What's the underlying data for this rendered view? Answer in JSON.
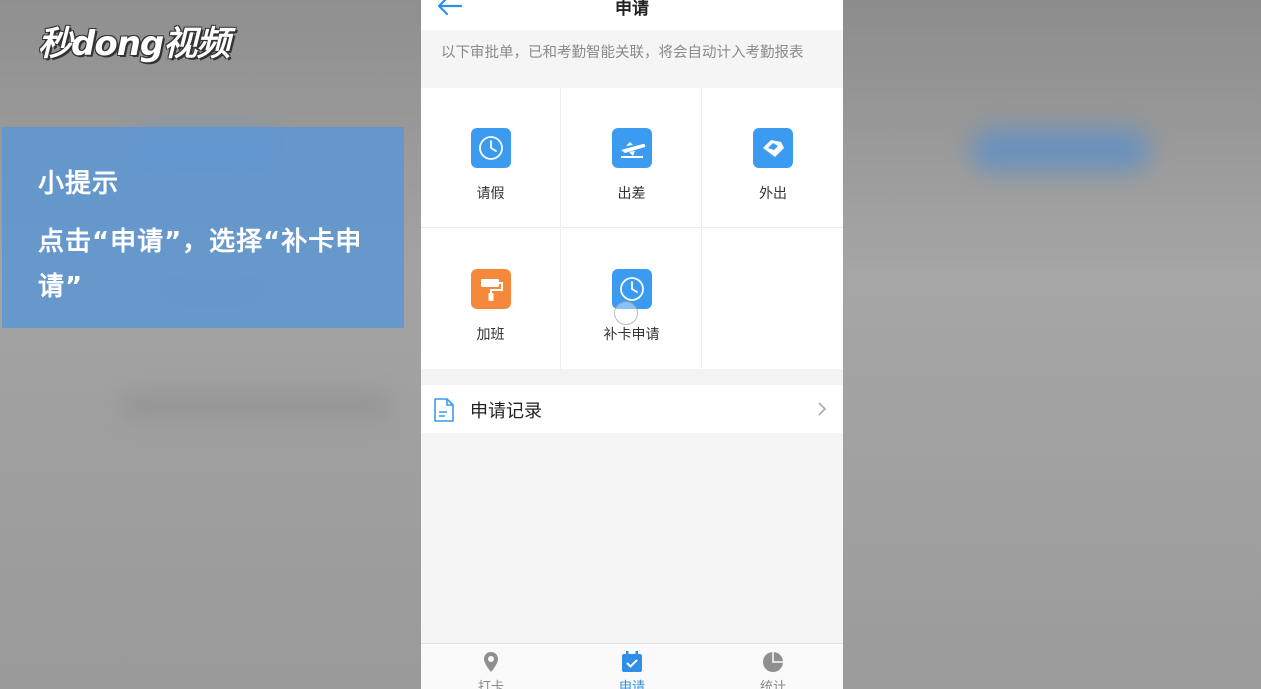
{
  "logo": {
    "text": "秒dong视频"
  },
  "tip": {
    "title": "小提示",
    "body": "点击“申请”，选择“补卡申请”"
  },
  "header": {
    "title": "申请"
  },
  "notice": "以下审批单，已和考勤智能关联，将会自动计入考勤报表",
  "apply_items": [
    {
      "label": "请假",
      "icon": "clock-icon",
      "color": "#3a9bf0"
    },
    {
      "label": "出差",
      "icon": "airplane-icon",
      "color": "#3a9bf0"
    },
    {
      "label": "外出",
      "icon": "handshake-icon",
      "color": "#3a9bf0"
    },
    {
      "label": "加班",
      "icon": "paint-roller-icon",
      "color": "#f5883a"
    },
    {
      "label": "补卡申请",
      "icon": "clock-icon",
      "color": "#3a9bf0"
    }
  ],
  "records": {
    "label": "申请记录",
    "icon": "document-icon"
  },
  "tabs": [
    {
      "label": "打卡",
      "icon": "location-pin-icon",
      "active": false
    },
    {
      "label": "申请",
      "icon": "calendar-check-icon",
      "active": true
    },
    {
      "label": "统计",
      "icon": "pie-chart-icon",
      "active": false
    }
  ],
  "colors": {
    "accent": "#2f8fe8",
    "tip_bg": "#5f96d2"
  }
}
